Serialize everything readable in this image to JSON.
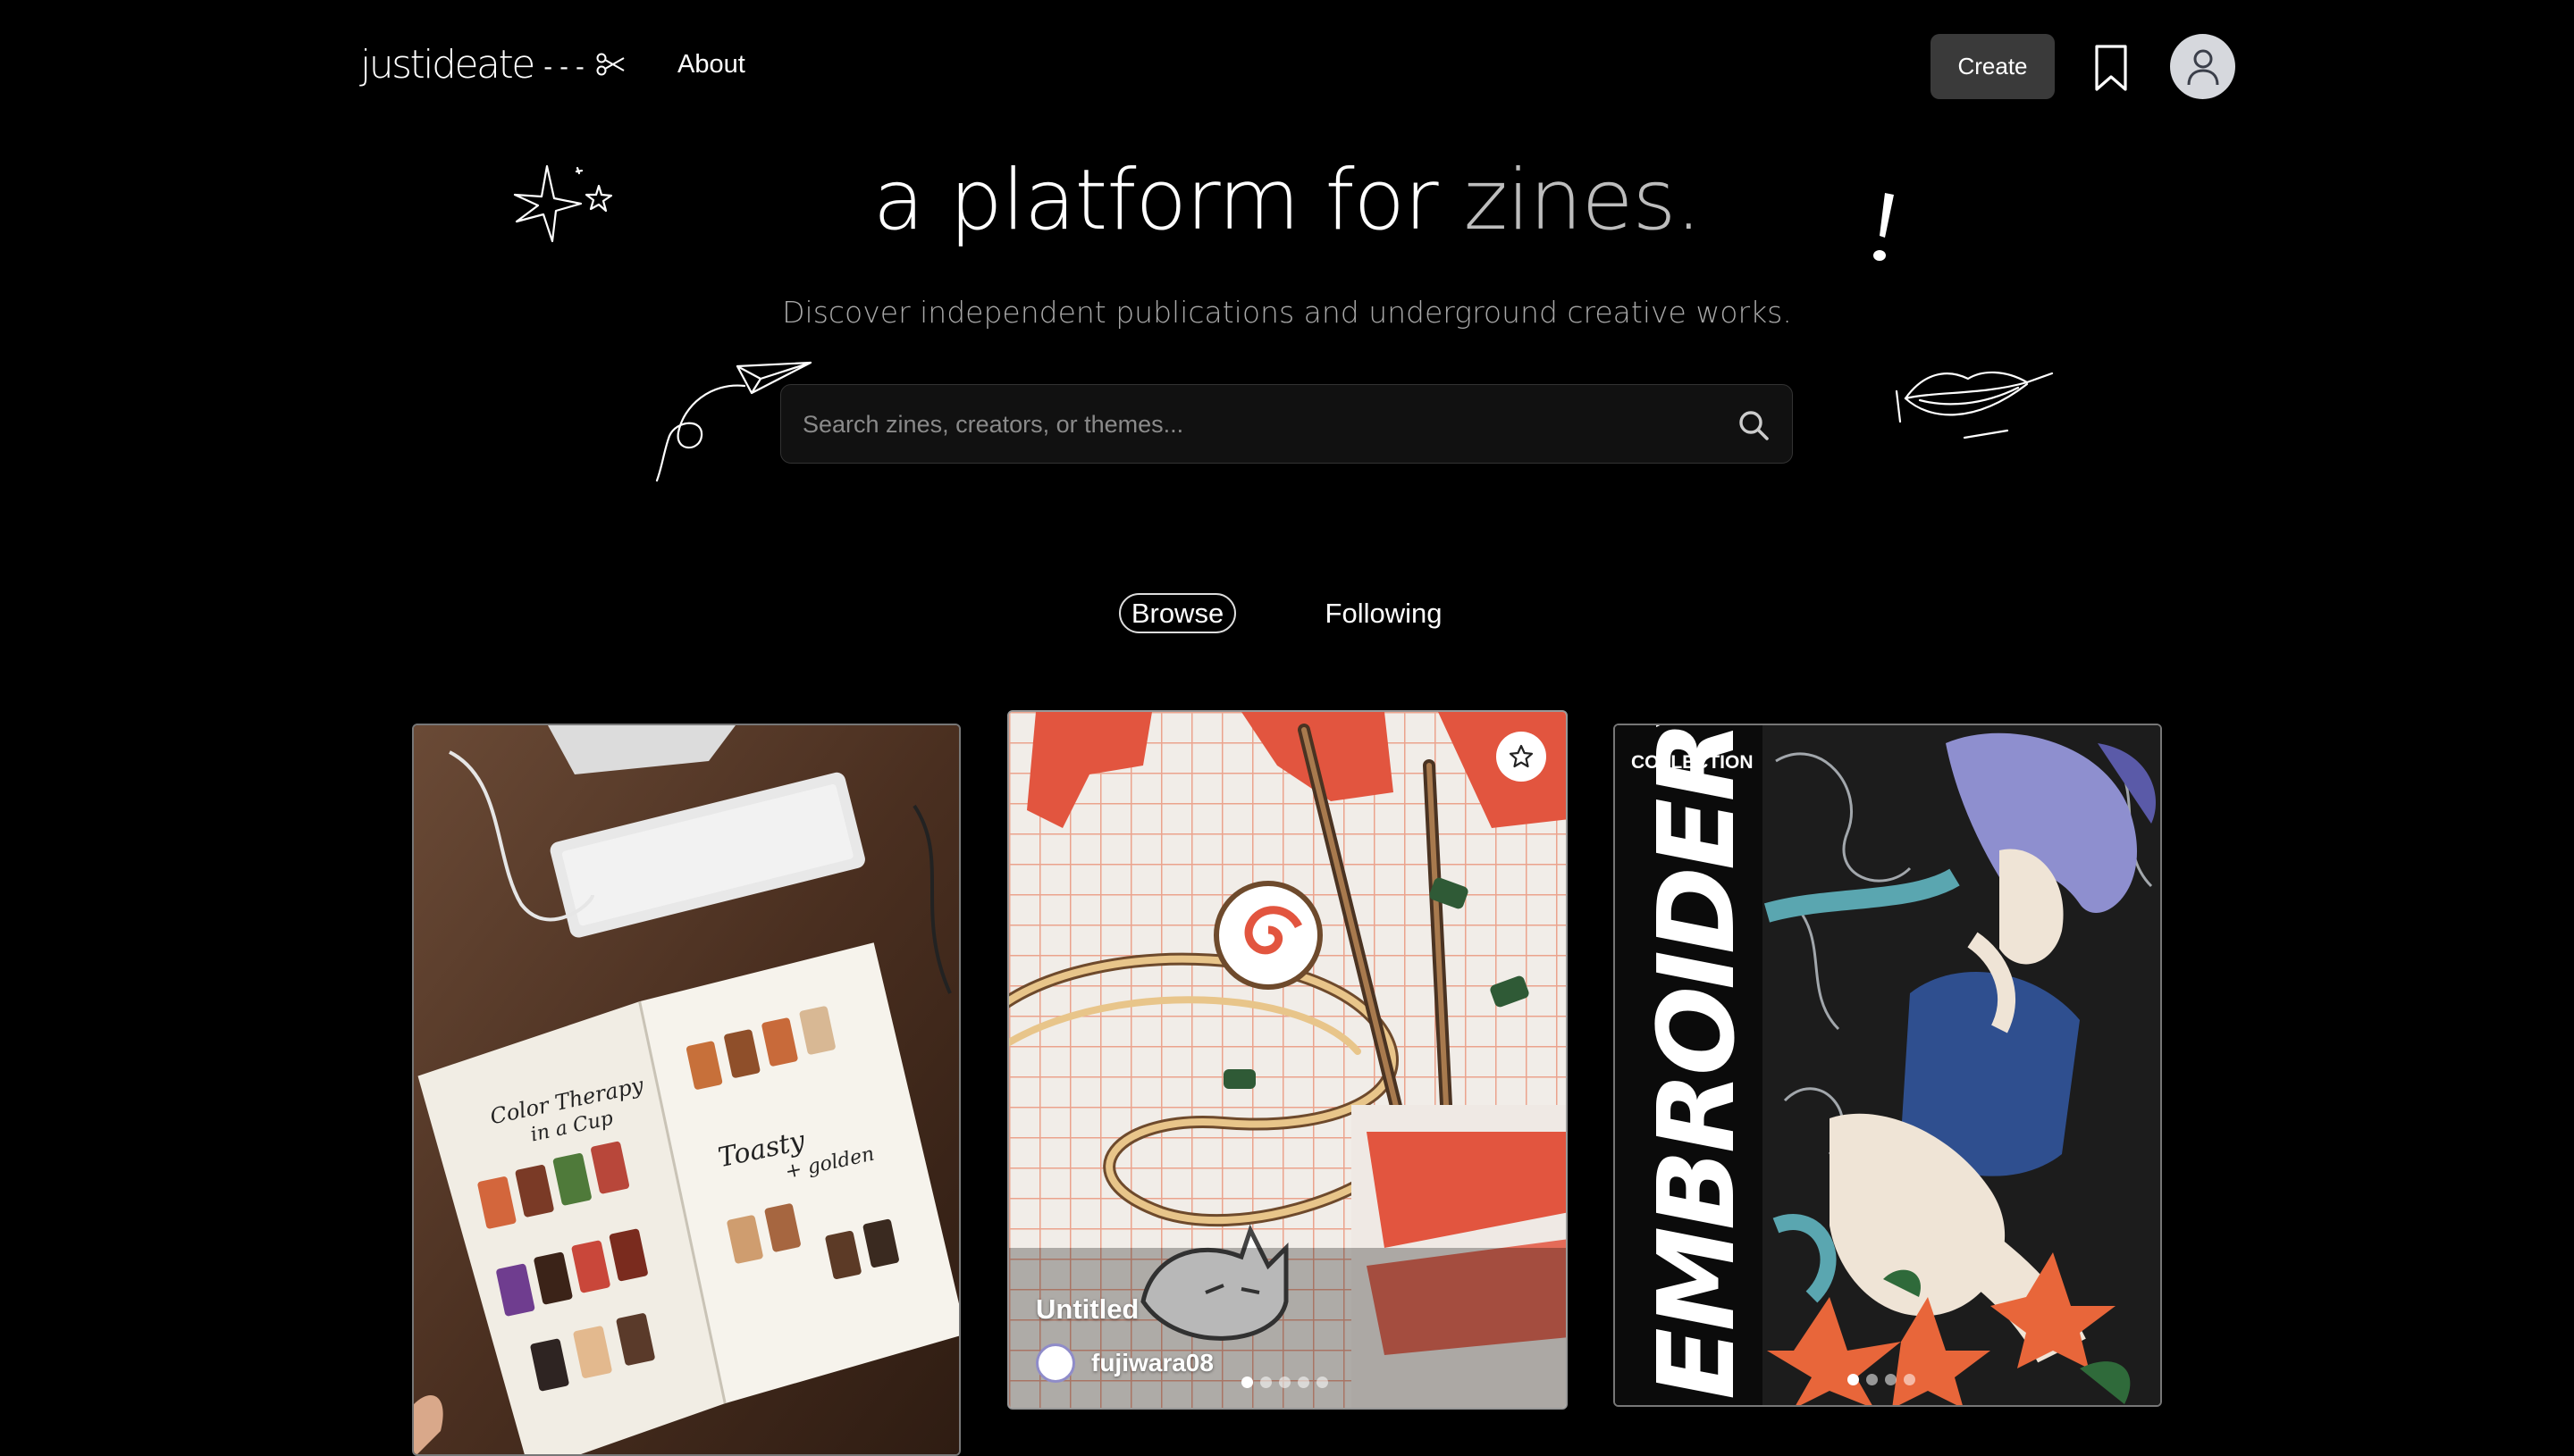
{
  "header": {
    "logo_text": "justideate",
    "logo_mark": "---",
    "nav_about": "About",
    "create_label": "Create"
  },
  "hero": {
    "title_main": "a platform for ",
    "title_highlight": "zines.",
    "subtitle": "Discover independent publications and underground creative works."
  },
  "search": {
    "placeholder": "Search zines, creators, or themes..."
  },
  "tabs": {
    "browse": "Browse",
    "following": "Following"
  },
  "cards": [
    {
      "zine_text_1": "Color Therapy in a Cup",
      "zine_text_2": "Toasty + golden"
    },
    {
      "title": "Untitled",
      "author": "fujiwara08",
      "dots_total": 5,
      "dots_active": 1
    },
    {
      "collection_label": "COLLECTION",
      "vertical_word": "EMBROIDERY",
      "dots_total": 4,
      "dots_active": 1
    }
  ],
  "icons": [
    "scissors-icon",
    "bookmark-icon",
    "user-icon",
    "search-icon",
    "star-icon"
  ],
  "colors": {
    "background": "#000000",
    "button": "#3a3a3a",
    "subtitle": "#a8a8a8",
    "title_highlight": "#bdbdbd"
  }
}
